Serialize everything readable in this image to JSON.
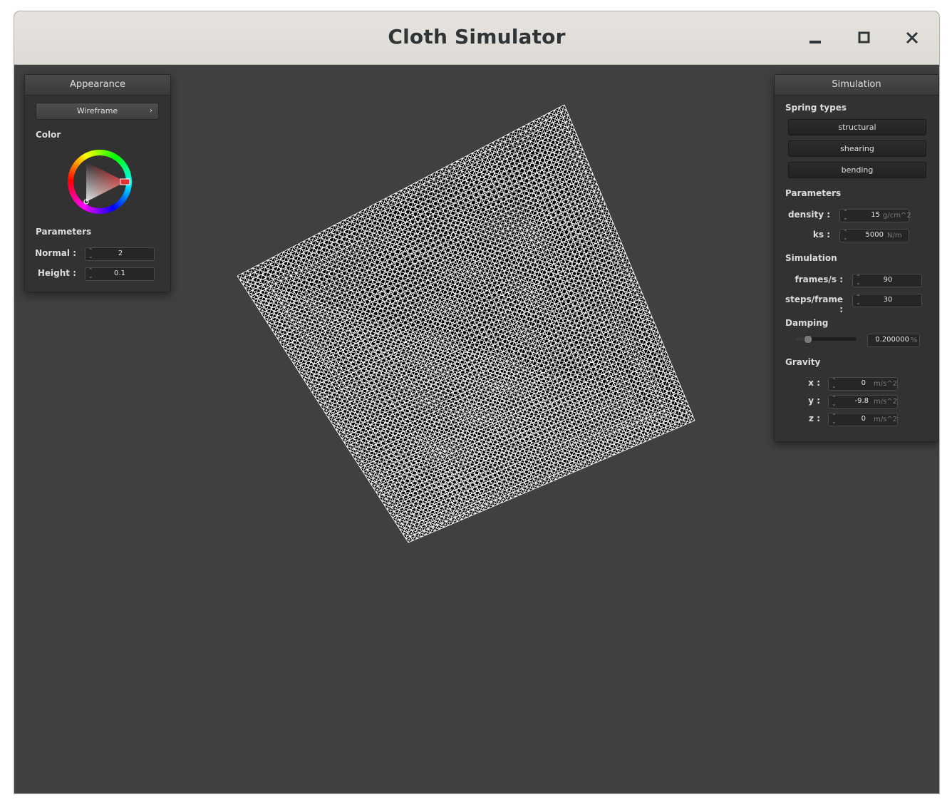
{
  "window": {
    "title": "Cloth Simulator"
  },
  "appearance": {
    "header": "Appearance",
    "shading_mode": "Wireframe",
    "color_label": "Color",
    "selected_color": "#e03030",
    "parameters_label": "Parameters",
    "normal_label": "Normal :",
    "normal_value": "2",
    "height_label": "Height :",
    "height_value": "0.1"
  },
  "simulation": {
    "header": "Simulation",
    "spring_types_label": "Spring types",
    "spring_types": [
      "structural",
      "shearing",
      "bending"
    ],
    "parameters_label": "Parameters",
    "density_label": "density :",
    "density_value": "15",
    "density_unit": "g/cm^2",
    "ks_label": "ks :",
    "ks_value": "5000",
    "ks_unit": "N/m",
    "simulation_label": "Simulation",
    "fps_label": "frames/s :",
    "fps_value": "90",
    "steps_label": "steps/frame :",
    "steps_value": "30",
    "damping_label": "Damping",
    "damping_value": "0.200000",
    "damping_unit": "%",
    "damping_fraction": 0.2,
    "gravity_label": "Gravity",
    "gravity_x_label": "x :",
    "gravity_x": "0",
    "gravity_y_label": "y :",
    "gravity_y": "-9.8",
    "gravity_z_label": "z :",
    "gravity_z": "0",
    "gravity_unit": "m/s^2"
  },
  "colors": {
    "viewport_bg": "#404040",
    "panel_bg": "#323232",
    "cloth_wire": "#ffffff",
    "cloth_fill": "#000000"
  },
  "icons": {
    "minimize": "minimize-icon",
    "maximize": "maximize-icon",
    "close": "close-icon"
  }
}
